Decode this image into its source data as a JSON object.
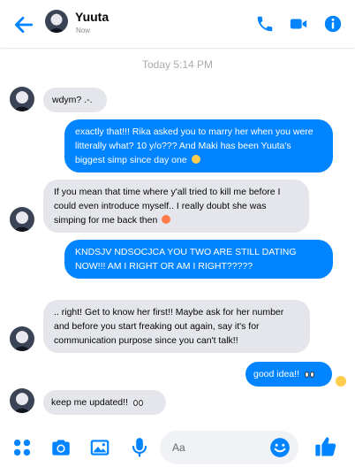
{
  "header": {
    "contact_name": "Yuuta",
    "status": "Now",
    "icons": [
      "back-arrow-icon",
      "phone-icon",
      "video-camera-icon",
      "info-icon"
    ]
  },
  "conversation": {
    "timestamp": "Today 5:14 PM",
    "messages": [
      {
        "sender": "contact",
        "text": "wdym? .-."
      },
      {
        "sender": "me",
        "text": "exactly that!!! Rika asked you to marry her when you were litterally what? 10 y/o??? And Maki has been Yuuta's biggest simp since day one",
        "emoji": "flushed-face"
      },
      {
        "sender": "contact",
        "text": "If you mean that time where y'all tried to kill me before I could even introduce myself.. I really doubt she was simping for me back then",
        "emoji": "smiling-face-with-hearts"
      },
      {
        "sender": "me",
        "text": "KNDSJV NDSOCJCA YOU TWO ARE STILL DATING NOW!!! AM I RIGHT OR AM I RIGHT?????"
      },
      {
        "sender": "contact",
        "text": ".. right! Get to know her first!! Maybe ask for her number and before you start freaking out again, say it's for communication purpose since you can't talk!!"
      },
      {
        "sender": "me",
        "text": "good idea!!",
        "emoji": "eyes"
      },
      {
        "sender": "contact",
        "text": "keep me updated!!",
        "emoji": "eyes"
      }
    ]
  },
  "composer": {
    "placeholder": "Aa",
    "icons": [
      "apps-grid-icon",
      "camera-icon",
      "image-icon",
      "microphone-icon",
      "emoji-icon",
      "thumbs-up-icon"
    ]
  },
  "colors": {
    "accent": "#0084ff",
    "incoming_bubble": "#e4e6eb",
    "timestamp": "#a8abaf"
  }
}
